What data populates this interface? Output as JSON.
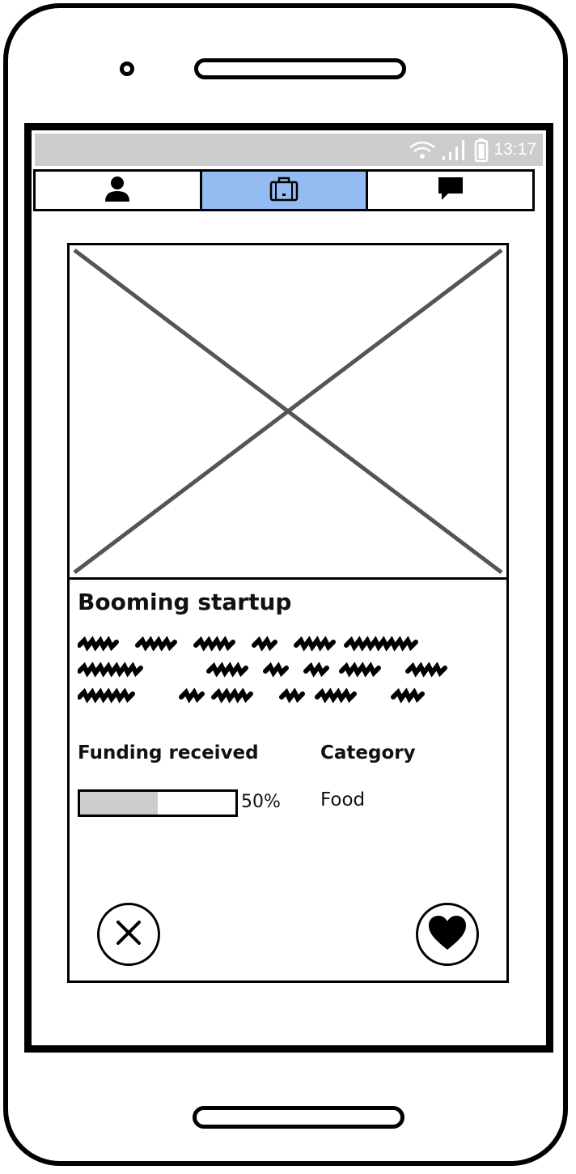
{
  "status_bar": {
    "time": "13:17",
    "icons": [
      "wifi-icon",
      "signal-icon",
      "battery-icon"
    ]
  },
  "tabs": [
    {
      "icon": "person-icon",
      "active": false
    },
    {
      "icon": "briefcase-icon",
      "active": true
    },
    {
      "icon": "chat-icon",
      "active": false
    }
  ],
  "card": {
    "title": "Booming startup",
    "funding_label": "Funding received",
    "funding_progress_percent": 50,
    "funding_progress_text": "50%",
    "category_label": "Category",
    "category_value": "Food",
    "actions": [
      "close-icon",
      "heart-icon"
    ]
  },
  "colors": {
    "active_tab": "#94bcf2",
    "status_bar": "#cccccc",
    "progress_fill": "#cccccc",
    "outline": "#000000"
  }
}
